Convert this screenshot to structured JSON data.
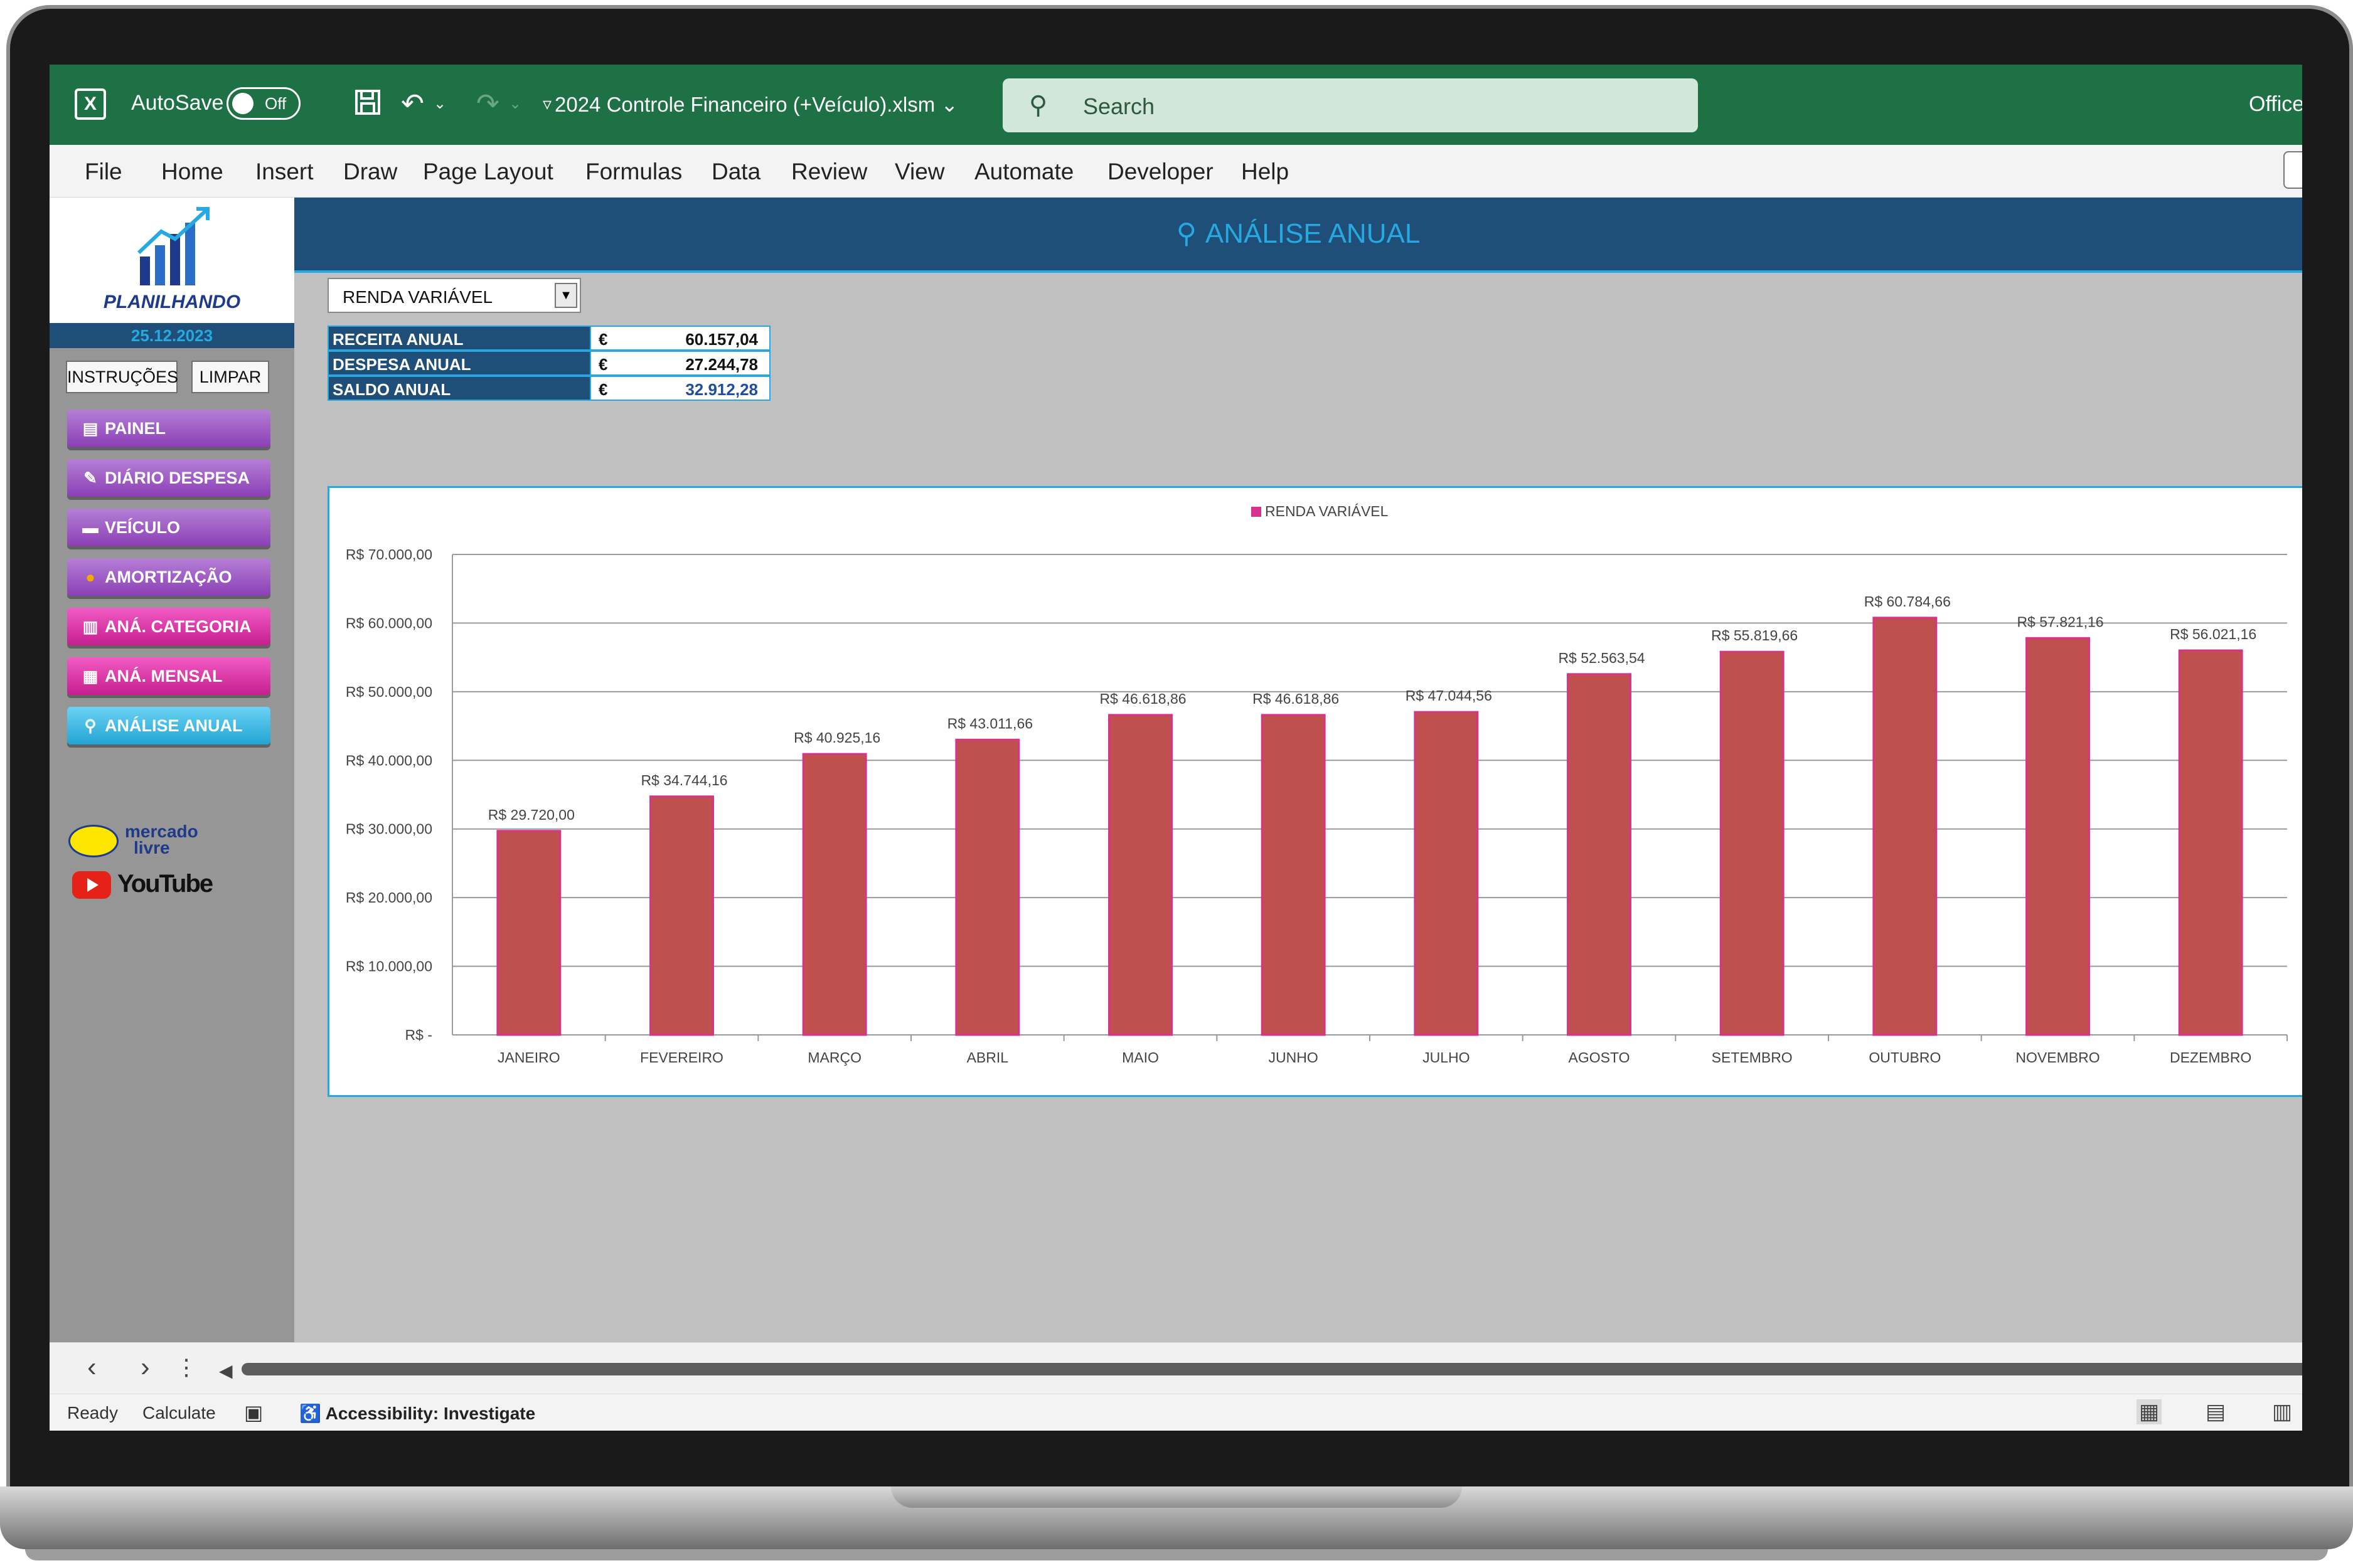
{
  "titlebar": {
    "autosave_label": "AutoSave",
    "toggle_state": "Off",
    "filename": "2024 Controle Financeiro (+Veículo).xlsm",
    "search_placeholder": "Search",
    "office_label": "Office",
    "icons": [
      "excel-icon",
      "save-icon",
      "undo-icon",
      "redo-icon",
      "customize-icon",
      "search-icon"
    ]
  },
  "menu": {
    "items": [
      "File",
      "Home",
      "Insert",
      "Draw",
      "Page Layout",
      "Formulas",
      "Data",
      "Review",
      "View",
      "Automate",
      "Developer",
      "Help"
    ]
  },
  "sidebar": {
    "logo_text": "PLANILHANDO",
    "date": "25.12.2023",
    "instrucoes_label": "INSTRUÇÕES",
    "limpar_label": "LIMPAR",
    "nav": [
      {
        "label": "PAINEL",
        "icon": "clipboard-icon",
        "color": "purple"
      },
      {
        "label": "DIÁRIO DESPESA",
        "icon": "money-icon",
        "color": "purple"
      },
      {
        "label": "VEÍCULO",
        "icon": "car-icon",
        "color": "purple"
      },
      {
        "label": "AMORTIZAÇÃO",
        "icon": "coin-icon",
        "color": "purple"
      },
      {
        "label": "ANÁ. CATEGORIA",
        "icon": "chart-icon",
        "color": "pink"
      },
      {
        "label": "ANÁ. MENSAL",
        "icon": "calendar-icon",
        "color": "pink"
      },
      {
        "label": "ANÁLISE ANUAL",
        "icon": "magnifier-icon",
        "color": "blue"
      }
    ],
    "mercado_label_1": "mercado",
    "mercado_label_2": "livre",
    "youtube_label": "YouTube"
  },
  "main": {
    "title": "ANÁLISE ANUAL",
    "dropdown_value": "RENDA VARIÁVEL",
    "summary": [
      {
        "label": "RECEITA ANUAL",
        "currency": "€",
        "value": "60.157,04"
      },
      {
        "label": "DESPESA ANUAL",
        "currency": "€",
        "value": "27.244,78"
      },
      {
        "label": "SALDO ANUAL",
        "currency": "€",
        "value": "32.912,28"
      }
    ]
  },
  "chart_data": {
    "type": "bar",
    "legend": "RENDA VARIÁVEL",
    "legend_position": "top-center",
    "categories": [
      "JANEIRO",
      "FEVEREIRO",
      "MARÇO",
      "ABRIL",
      "MAIO",
      "JUNHO",
      "JULHO",
      "AGOSTO",
      "SETEMBRO",
      "OUTUBRO",
      "NOVEMBRO",
      "DEZEMBRO"
    ],
    "values": [
      29720.0,
      34744.16,
      40925.16,
      43011.66,
      46618.86,
      46618.86,
      47044.56,
      52563.54,
      55819.66,
      60784.66,
      57821.16,
      56021.16
    ],
    "data_labels": [
      "R$ 29.720,00",
      "R$ 34.744,16",
      "R$ 40.925,16",
      "R$ 43.011,66",
      "R$ 46.618,86",
      "R$ 46.618,86",
      "R$ 47.044,56",
      "R$ 52.563,54",
      "R$ 55.819,66",
      "R$ 60.784,66",
      "R$ 57.821,16",
      "R$ 56.021,16"
    ],
    "ylim": [
      0,
      70000
    ],
    "yticks": [
      0,
      10000,
      20000,
      30000,
      40000,
      50000,
      60000,
      70000
    ],
    "ytick_labels": [
      "R$ -",
      "R$ 10.000,00",
      "R$ 20.000,00",
      "R$ 30.000,00",
      "R$ 40.000,00",
      "R$ 50.000,00",
      "R$ 60.000,00",
      "R$ 70.000,00"
    ],
    "grid": true,
    "bar_color": "#c0504d",
    "bar_border_color": "#d6338a"
  },
  "statusbar": {
    "ready": "Ready",
    "calculate": "Calculate",
    "accessibility": "Accessibility: Investigate"
  },
  "colors": {
    "excel_green": "#1d7145",
    "header_navy": "#1f4e79",
    "accent_cyan": "#25a9e0"
  }
}
